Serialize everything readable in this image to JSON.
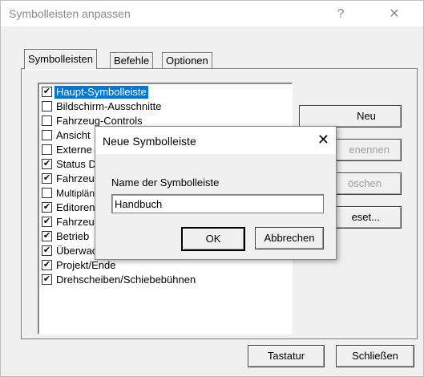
{
  "window": {
    "title": "Symbolleisten anpassen",
    "help_glyph": "?",
    "close_glyph": "✕"
  },
  "tabs": [
    {
      "label": "Symbolleisten",
      "selected": true
    },
    {
      "label": "Befehle",
      "selected": false
    },
    {
      "label": "Optionen",
      "selected": false
    }
  ],
  "toolbar_list": [
    {
      "label": "Haupt-Symbolleiste",
      "checked": true,
      "selected": true
    },
    {
      "label": "Bildschirm-Ausschnitte",
      "checked": false
    },
    {
      "label": "Fahrzeug-Controls",
      "checked": false
    },
    {
      "label": "Ansicht",
      "checked": false
    },
    {
      "label": "Externe",
      "checked": false
    },
    {
      "label": "Status D",
      "checked": true
    },
    {
      "label": "Fahrzeu",
      "checked": true
    },
    {
      "label": "Multiplän",
      "checked": false
    },
    {
      "label": "Editoren",
      "checked": true
    },
    {
      "label": "Fahrzeu",
      "checked": true
    },
    {
      "label": "Betrieb",
      "checked": true
    },
    {
      "label": "Überwachung",
      "checked": true
    },
    {
      "label": "Projekt/Ende",
      "checked": true
    },
    {
      "label": "Drehscheiben/Schiebebühnen",
      "checked": true
    }
  ],
  "side_buttons": {
    "new": "Neu",
    "rename": "enennen",
    "delete": "öschen",
    "reset": "eset..."
  },
  "bottom_buttons": {
    "keyboard": "Tastatur",
    "close": "Schließen"
  },
  "modal": {
    "title": "Neue Symbolleiste",
    "close_glyph": "✕",
    "field_label": "Name der Symbolleiste",
    "field_value": "Handbuch",
    "ok": "OK",
    "cancel": "Abbrechen"
  },
  "check_glyph": "✔",
  "colors": {
    "selection": "#0078d7",
    "dialog_bg": "#f0f0f0"
  }
}
